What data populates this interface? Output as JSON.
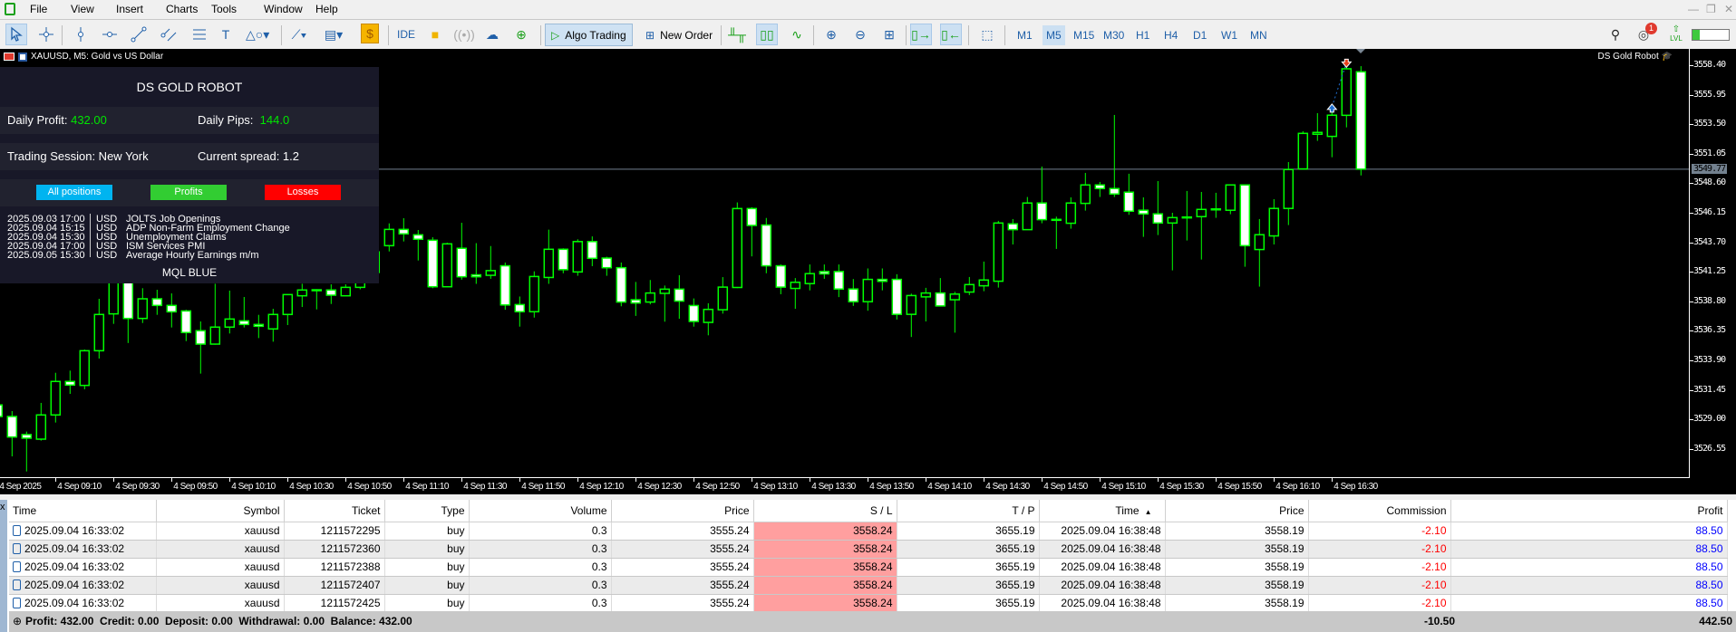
{
  "menu": [
    "File",
    "View",
    "Insert",
    "Charts",
    "Tools",
    "Window",
    "Help"
  ],
  "toolbar": {
    "ide": "IDE",
    "algo": "Algo Trading",
    "new_order": "New Order",
    "timeframes": [
      "M1",
      "M5",
      "M15",
      "M30",
      "H1",
      "H4",
      "D1",
      "W1",
      "MN"
    ],
    "active_timeframe": "M5",
    "notification_count": "1",
    "lvl": "LVL",
    "level_progress": 0.2
  },
  "chart": {
    "title": "XAUUSD, M5:  Gold vs US Dollar",
    "robot_label": "DS Gold Robot",
    "current_price": "3549.77"
  },
  "panel": {
    "title": "DS GOLD ROBOT",
    "daily_profit_label": "Daily Profit:",
    "daily_profit": "432.00",
    "daily_pips_label": "Daily Pips:",
    "daily_pips": "144.0",
    "session_label": "Trading Session: New York",
    "spread_label": "Current spread: 1.2",
    "buttons": [
      {
        "label": "All positions",
        "color": "#00b4f0"
      },
      {
        "label": "Profits",
        "color": "#32cd32"
      },
      {
        "label": "Losses",
        "color": "#ff0000"
      }
    ],
    "events": [
      {
        "time": "2025.09.03 17:00",
        "cur": "USD",
        "name": "JOLTS Job Openings"
      },
      {
        "time": "2025.09.04 15:15",
        "cur": "USD",
        "name": "ADP Non-Farm Employment Change"
      },
      {
        "time": "2025.09.04 15:30",
        "cur": "USD",
        "name": "Unemployment Claims"
      },
      {
        "time": "2025.09.04 17:00",
        "cur": "USD",
        "name": "ISM Services PMI"
      },
      {
        "time": "2025.09.05 15:30",
        "cur": "USD",
        "name": "Average Hourly Earnings m/m"
      }
    ],
    "footer": "MQL BLUE"
  },
  "chart_data": {
    "type": "candlestick",
    "symbol": "XAUUSD",
    "timeframe": "M5",
    "ylim": [
      3524.8,
      3559.6
    ],
    "price_ticks": [
      "3558.40",
      "3555.95",
      "3553.50",
      "3551.05",
      "3548.60",
      "3546.15",
      "3543.70",
      "3541.25",
      "3538.80",
      "3536.35",
      "3533.90",
      "3531.45",
      "3529.00",
      "3526.55"
    ],
    "time_ticks": [
      "4 Sep 2025",
      "4 Sep 09:10",
      "4 Sep 09:30",
      "4 Sep 09:50",
      "4 Sep 10:10",
      "4 Sep 10:30",
      "4 Sep 10:50",
      "4 Sep 11:10",
      "4 Sep 11:30",
      "4 Sep 11:50",
      "4 Sep 12:10",
      "4 Sep 12:30",
      "4 Sep 12:50",
      "4 Sep 13:10",
      "4 Sep 13:30",
      "4 Sep 13:50",
      "4 Sep 14:10",
      "4 Sep 14:30",
      "4 Sep 14:50",
      "4 Sep 15:10",
      "4 Sep 15:30",
      "4 Sep 15:50",
      "4 Sep 16:10",
      "4 Sep 16:30"
    ],
    "bars_per_tick": 4,
    "ohlc": [
      [
        3530.2,
        3530.4,
        3529.0,
        3529.24
      ],
      [
        3529.24,
        3529.69,
        3525.93,
        3527.54
      ],
      [
        3527.74,
        3527.99,
        3524.68,
        3527.44
      ],
      [
        3527.36,
        3530.37,
        3527.24,
        3529.37
      ],
      [
        3529.37,
        3532.87,
        3528.74,
        3532.15
      ],
      [
        3532.15,
        3533.05,
        3531.12,
        3531.85
      ],
      [
        3531.82,
        3534.8,
        3531.5,
        3534.7
      ],
      [
        3534.7,
        3539.01,
        3534.05,
        3537.71
      ],
      [
        3537.76,
        3542.0,
        3536.93,
        3541.3
      ],
      [
        3540.4,
        3541.0,
        3535.34,
        3537.38
      ],
      [
        3537.38,
        3539.89,
        3537.0,
        3539.01
      ],
      [
        3539.01,
        3539.76,
        3537.68,
        3538.46
      ],
      [
        3538.46,
        3539.46,
        3536.63,
        3537.93
      ],
      [
        3538.0,
        3538.1,
        3535.5,
        3536.21
      ],
      [
        3536.36,
        3537.13,
        3532.8,
        3535.25
      ],
      [
        3535.25,
        3540.26,
        3535.2,
        3536.66
      ],
      [
        3536.66,
        3539.69,
        3536.13,
        3537.33
      ],
      [
        3537.18,
        3539.16,
        3536.63,
        3536.88
      ],
      [
        3536.88,
        3537.68,
        3535.75,
        3536.73
      ],
      [
        3536.51,
        3538.18,
        3535.45,
        3537.71
      ],
      [
        3537.71,
        3539.36,
        3536.83,
        3539.36
      ],
      [
        3539.26,
        3540.26,
        3538.33,
        3539.74
      ],
      [
        3539.76,
        3539.81,
        3538.13,
        3539.76
      ],
      [
        3539.74,
        3540.21,
        3538.58,
        3539.31
      ],
      [
        3539.26,
        3540.21,
        3539.26,
        3539.96
      ],
      [
        3539.96,
        3541.0,
        3539.8,
        3540.5
      ],
      [
        3541.2,
        3543.5,
        3541.14,
        3542.9
      ],
      [
        3543.42,
        3545.27,
        3542.94,
        3544.77
      ],
      [
        3544.77,
        3545.7,
        3543.77,
        3544.4
      ],
      [
        3544.32,
        3544.72,
        3542.19,
        3543.95
      ],
      [
        3543.87,
        3544.12,
        3539.89,
        3540.01
      ],
      [
        3540.01,
        3543.67,
        3540.0,
        3543.57
      ],
      [
        3543.2,
        3545.32,
        3540.6,
        3540.84
      ],
      [
        3541.0,
        3543.63,
        3540.25,
        3540.84
      ],
      [
        3540.96,
        3543.39,
        3540.67,
        3541.35
      ],
      [
        3541.75,
        3542.02,
        3538.1,
        3538.5
      ],
      [
        3538.53,
        3539.2,
        3536.7,
        3537.94
      ],
      [
        3537.94,
        3541.29,
        3537.45,
        3540.86
      ],
      [
        3540.78,
        3544.75,
        3540.25,
        3543.12
      ],
      [
        3543.12,
        3543.2,
        3541.13,
        3541.43
      ],
      [
        3541.24,
        3543.95,
        3540.92,
        3543.76
      ],
      [
        3543.76,
        3544.19,
        3541.72,
        3542.37
      ],
      [
        3542.39,
        3542.5,
        3540.92,
        3541.59
      ],
      [
        3541.59,
        3542.02,
        3538.39,
        3538.74
      ],
      [
        3538.93,
        3540.41,
        3537.59,
        3538.66
      ],
      [
        3538.74,
        3540.57,
        3538.55,
        3539.49
      ],
      [
        3539.46,
        3540.11,
        3537.11,
        3539.81
      ],
      [
        3539.81,
        3540.97,
        3537.35,
        3538.82
      ],
      [
        3538.45,
        3539.04,
        3536.7,
        3537.13
      ],
      [
        3537.05,
        3538.64,
        3535.98,
        3538.13
      ],
      [
        3538.1,
        3540.81,
        3537.78,
        3539.98
      ],
      [
        3539.95,
        3547.01,
        3539.9,
        3546.5
      ],
      [
        3546.5,
        3546.61,
        3542.53,
        3545.1
      ],
      [
        3545.13,
        3545.72,
        3541.13,
        3541.75
      ],
      [
        3541.75,
        3541.86,
        3539.39,
        3539.98
      ],
      [
        3539.87,
        3540.73,
        3538.18,
        3540.38
      ],
      [
        3540.27,
        3541.86,
        3539.71,
        3541.1
      ],
      [
        3541.27,
        3541.86,
        3540.67,
        3541.08
      ],
      [
        3541.27,
        3541.86,
        3539.15,
        3539.82
      ],
      [
        3539.82,
        3540.65,
        3538.42,
        3538.77
      ],
      [
        3538.77,
        3541.53,
        3538.02,
        3540.62
      ],
      [
        3540.62,
        3541.53,
        3539.71,
        3540.46
      ],
      [
        3540.62,
        3541.05,
        3537.29,
        3537.72
      ],
      [
        3537.72,
        3539.44,
        3535.84,
        3539.28
      ],
      [
        3539.17,
        3539.92,
        3537.13,
        3539.49
      ],
      [
        3539.49,
        3540.73,
        3538.37,
        3538.42
      ],
      [
        3538.93,
        3539.59,
        3536.2,
        3539.4
      ],
      [
        3539.57,
        3540.82,
        3539.32,
        3540.19
      ],
      [
        3540.09,
        3542.1,
        3539.64,
        3540.57
      ],
      [
        3540.47,
        3545.48,
        3539.94,
        3545.3
      ],
      [
        3545.23,
        3545.63,
        3543.52,
        3544.75
      ],
      [
        3544.75,
        3547.46,
        3544.75,
        3546.96
      ],
      [
        3546.96,
        3549.99,
        3545.28,
        3545.58
      ],
      [
        3545.58,
        3545.83,
        3543.15,
        3545.6
      ],
      [
        3545.28,
        3547.43,
        3544.83,
        3546.96
      ],
      [
        3546.93,
        3549.46,
        3546.33,
        3548.46
      ],
      [
        3548.46,
        3548.71,
        3547.46,
        3548.16
      ],
      [
        3548.16,
        3554.27,
        3547.46,
        3547.71
      ],
      [
        3547.86,
        3549.39,
        3545.98,
        3546.28
      ],
      [
        3546.36,
        3547.43,
        3544.15,
        3546.06
      ],
      [
        3546.06,
        3548.78,
        3544.3,
        3545.3
      ],
      [
        3545.3,
        3546.15,
        3541.37,
        3545.75
      ],
      [
        3545.78,
        3547.96,
        3543.85,
        3545.8
      ],
      [
        3545.83,
        3547.88,
        3542.27,
        3546.43
      ],
      [
        3546.45,
        3547.81,
        3545.73,
        3546.47
      ],
      [
        3546.36,
        3548.46,
        3546.03,
        3548.46
      ],
      [
        3548.46,
        3548.46,
        3541.67,
        3543.42
      ],
      [
        3543.1,
        3545.63,
        3540.02,
        3544.33
      ],
      [
        3544.23,
        3547.28,
        3543.52,
        3546.51
      ],
      [
        3546.51,
        3550.36,
        3545.13,
        3549.74
      ],
      [
        3549.79,
        3552.92,
        3549.74,
        3552.74
      ],
      [
        3552.67,
        3554.42,
        3552.12,
        3552.82
      ],
      [
        3552.49,
        3554.8,
        3550.76,
        3554.25
      ],
      [
        3554.24,
        3558.4,
        3553.24,
        3558.1
      ],
      [
        3557.85,
        3558.32,
        3549.25,
        3549.77
      ]
    ],
    "signals": [
      {
        "type": "buy",
        "bar": 92,
        "price": 3554.95
      },
      {
        "type": "sell",
        "bar": 93,
        "price": 3558.6
      }
    ],
    "bull_color": "#000000",
    "bear_color": "#ffffff",
    "outline_color": "#00ff00",
    "bid_line": 3549.77
  },
  "terminal": {
    "columns": [
      "Time",
      "Symbol",
      "Ticket",
      "Type",
      "Volume",
      "Price",
      "S / L",
      "T / P",
      "Time",
      "Price",
      "Commission",
      "Profit"
    ],
    "sort_indicator": "▲",
    "rows": [
      [
        "2025.09.04 16:33:02",
        "xauusd",
        "1211572295",
        "buy",
        "0.3",
        "3555.24",
        "3558.24",
        "3655.19",
        "2025.09.04 16:38:48",
        "3558.19",
        "-2.10",
        "88.50"
      ],
      [
        "2025.09.04 16:33:02",
        "xauusd",
        "1211572360",
        "buy",
        "0.3",
        "3555.24",
        "3558.24",
        "3655.19",
        "2025.09.04 16:38:48",
        "3558.19",
        "-2.10",
        "88.50"
      ],
      [
        "2025.09.04 16:33:02",
        "xauusd",
        "1211572388",
        "buy",
        "0.3",
        "3555.24",
        "3558.24",
        "3655.19",
        "2025.09.04 16:38:48",
        "3558.19",
        "-2.10",
        "88.50"
      ],
      [
        "2025.09.04 16:33:02",
        "xauusd",
        "1211572407",
        "buy",
        "0.3",
        "3555.24",
        "3558.24",
        "3655.19",
        "2025.09.04 16:38:48",
        "3558.19",
        "-2.10",
        "88.50"
      ],
      [
        "2025.09.04 16:33:02",
        "xauusd",
        "1211572425",
        "buy",
        "0.3",
        "3555.24",
        "3558.24",
        "3655.19",
        "2025.09.04 16:38:48",
        "3558.19",
        "-2.10",
        "88.50"
      ]
    ],
    "footer": {
      "summary": "Profit: 432.00  Credit: 0.00  Deposit: 0.00  Withdrawal: 0.00  Balance: 432.00",
      "commission_total": "-10.50",
      "profit_total": "442.50"
    }
  }
}
